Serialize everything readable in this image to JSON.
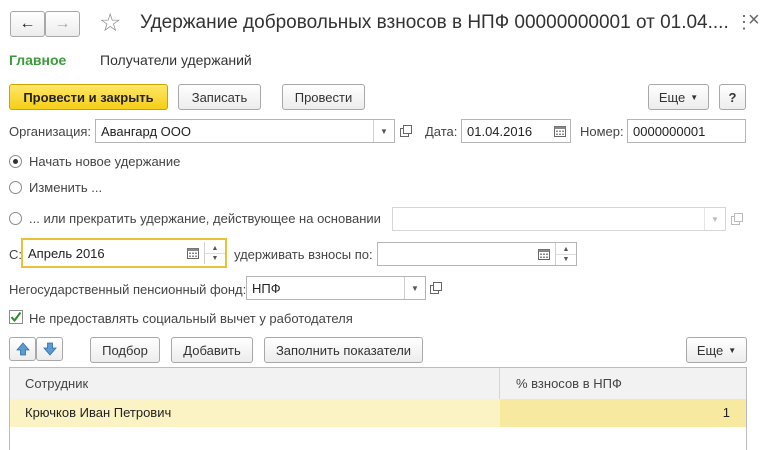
{
  "window": {
    "title": "Удержание добровольных взносов в НПФ 00000000001 от 01.04....",
    "back_glyph": "←",
    "forward_glyph": "→",
    "star_glyph": "☆",
    "menu_glyph": "⋮",
    "close_glyph": "×"
  },
  "tabs": [
    {
      "label": "Главное",
      "active": true
    },
    {
      "label": "Получатели удержаний",
      "active": false
    }
  ],
  "toolbar": {
    "post_and_close": "Провести и закрыть",
    "save": "Записать",
    "post": "Провести",
    "more": "Еще",
    "help": "?"
  },
  "form": {
    "org_label": "Организация:",
    "org_value": "Авангард ООО",
    "date_label": "Дата:",
    "date_value": "01.04.2016",
    "number_label": "Номер:",
    "number_value": "0000000001",
    "radio_new": "Начать новое удержание",
    "radio_change": "Изменить ...",
    "radio_stop": "... или прекратить удержание, действующее на основании",
    "basis_value": "",
    "from_label": "С:",
    "from_value": "Апрель 2016",
    "until_label": "удерживать взносы по:",
    "until_value": "",
    "fund_label": "Негосударственный пенсионный фонд:",
    "fund_value": "НПФ",
    "no_deduction_label": "Не предоставлять социальный вычет у работодателя",
    "no_deduction_checked": true
  },
  "table_toolbar": {
    "pick": "Подбор",
    "add": "Добавить",
    "fill": "Заполнить показатели",
    "more": "Еще"
  },
  "table": {
    "columns": [
      "Сотрудник",
      "% взносов в НПФ"
    ],
    "rows": [
      {
        "employee": "Крючков Иван Петрович",
        "percent": "1"
      }
    ]
  },
  "colors": {
    "accent_green": "#3c9a3c",
    "primary_yellow": "#f5cf17",
    "selected_row": "#fbf3c4",
    "focus_border": "#e8c33a"
  }
}
